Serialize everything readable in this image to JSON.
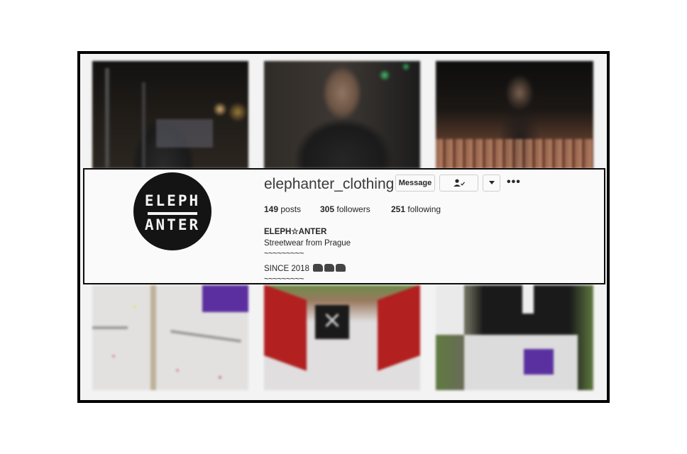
{
  "profile": {
    "username": "elephanter_clothing",
    "avatar_text_top": "ELEPH",
    "avatar_text_bottom": "ANTER",
    "buttons": {
      "message": "Message",
      "follow_icon": "user-check-icon",
      "dropdown_icon": "caret-down-icon",
      "more_icon": "more-dots-icon"
    },
    "stats": {
      "posts_count": "149",
      "posts_label": "posts",
      "followers_count": "305",
      "followers_label": "followers",
      "following_count": "251",
      "following_label": "following"
    },
    "bio": {
      "name": "ELEPH☆ANTER",
      "line1": "Streetwear from Prague",
      "line2": "~~~~~~~~~",
      "line3": "SINCE 2018",
      "line4": "~~~~~~~~~"
    },
    "icons": [
      "elephant-icon",
      "elephant-icon",
      "elephant-icon"
    ]
  },
  "colors": {
    "frame": "#000000",
    "background": "#fafafa",
    "text": "#262626"
  }
}
